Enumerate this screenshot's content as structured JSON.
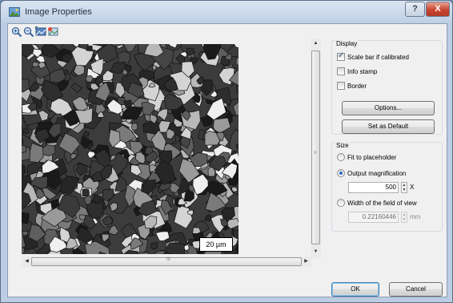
{
  "window": {
    "title": "Image Properties",
    "help_glyph": "?",
    "close_glyph": "X"
  },
  "toolbar": {
    "icons": [
      "zoom-in-icon",
      "zoom-out-icon",
      "fit-image-icon",
      "image-refresh-icon"
    ]
  },
  "image": {
    "scale_bar_label": "20 µm"
  },
  "scrollbars": {
    "up_arrow": "▲",
    "down_arrow": "▼",
    "left_arrow": "◀",
    "right_arrow": "▶",
    "vertical_grip": "≡",
    "horizontal_grip": "III"
  },
  "display": {
    "title": "Display",
    "scale_bar_label": "Scale bar if calibrated",
    "scale_bar_checked": true,
    "info_stamp_label": "Info stamp",
    "info_stamp_checked": false,
    "border_label": "Border",
    "border_checked": false,
    "options_label": "Options...",
    "default_label": "Set as Default"
  },
  "size": {
    "title": "Size",
    "fit_label": "Fit to placeholder",
    "output_mag_label": "Output magnification",
    "output_mag_value": "500",
    "output_mag_unit": "X",
    "width_label": "Width of the field of view",
    "width_value": "0.22160446",
    "width_unit": "mm",
    "selected": "output_magnification"
  },
  "footer": {
    "ok_label": "OK",
    "cancel_label": "Cancel"
  },
  "colors": {
    "title_bar": "#bccde3",
    "dialog_bg": "#f0f0f0",
    "close_button": "#c9452f"
  }
}
